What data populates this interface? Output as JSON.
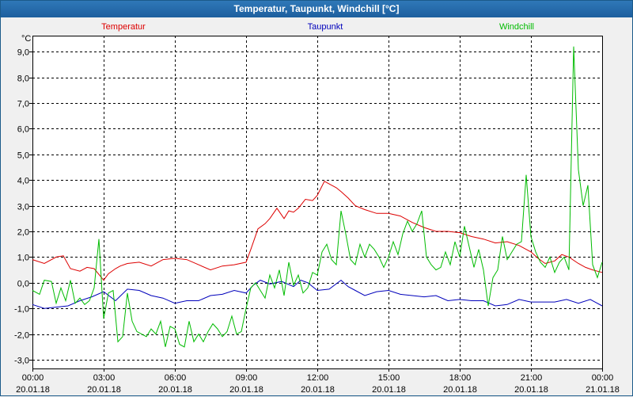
{
  "window": {
    "title": "Temperatur, Taupunkt, Windchill [°C]"
  },
  "chart_data": {
    "type": "line",
    "title": "Temperatur, Taupunkt, Windchill [°C]",
    "y_unit": "°C",
    "ylim": [
      -3.25,
      9.7
    ],
    "xlim_hours": [
      0,
      24
    ],
    "grid": true,
    "legend_placement": "top",
    "y_ticks": [
      "-3,0",
      "-2,0",
      "-1,0",
      "0,0",
      "1,0",
      "2,0",
      "3,0",
      "4,0",
      "5,0",
      "6,0",
      "7,0",
      "8,0",
      "9,0"
    ],
    "y_tick_values": [
      -3,
      -2,
      -1,
      0,
      1,
      2,
      3,
      4,
      5,
      6,
      7,
      8,
      9
    ],
    "x_ticks": [
      {
        "time": "00:00",
        "date": "20.01.18"
      },
      {
        "time": "03:00",
        "date": "20.01.18"
      },
      {
        "time": "06:00",
        "date": "20.01.18"
      },
      {
        "time": "09:00",
        "date": "20.01.18"
      },
      {
        "time": "12:00",
        "date": "20.01.18"
      },
      {
        "time": "15:00",
        "date": "20.01.18"
      },
      {
        "time": "18:00",
        "date": "20.01.18"
      },
      {
        "time": "21:00",
        "date": "20.01.18"
      },
      {
        "time": "00:00",
        "date": "21.01.18"
      }
    ],
    "x_tick_hours": [
      0,
      3,
      6,
      9,
      12,
      15,
      18,
      21,
      24
    ],
    "series": [
      {
        "name": "Temperatur",
        "color": "#dd0000",
        "x": [
          0,
          0.5,
          1,
          1.3,
          1.6,
          2,
          2.3,
          2.6,
          3,
          3.2,
          3.5,
          3.7,
          4,
          4.5,
          5,
          5.5,
          6,
          6.5,
          7,
          7.5,
          8,
          8.5,
          9,
          9.2,
          9.5,
          9.8,
          10,
          10.3,
          10.6,
          10.8,
          11,
          11.2,
          11.5,
          11.8,
          12,
          12.3,
          12.6,
          12.8,
          13,
          13.3,
          13.6,
          14,
          14.5,
          15,
          15.5,
          16,
          16.5,
          17,
          17.5,
          18,
          18.5,
          19,
          19.5,
          20,
          20.5,
          21,
          21.3,
          21.6,
          22,
          22.3,
          22.6,
          23,
          23.3,
          23.6,
          24
        ],
        "y": [
          0.9,
          0.75,
          1.0,
          1.05,
          0.55,
          0.45,
          0.6,
          0.55,
          0.1,
          0.35,
          0.55,
          0.65,
          0.75,
          0.8,
          0.65,
          0.9,
          0.95,
          0.9,
          0.7,
          0.5,
          0.65,
          0.7,
          0.8,
          1.3,
          2.1,
          2.3,
          2.5,
          2.9,
          2.5,
          2.8,
          2.75,
          2.9,
          3.25,
          3.2,
          3.4,
          3.95,
          3.8,
          3.7,
          3.55,
          3.3,
          3.0,
          2.85,
          2.7,
          2.7,
          2.6,
          2.35,
          2.15,
          2.0,
          2.0,
          1.95,
          1.8,
          1.7,
          1.55,
          1.6,
          1.45,
          1.2,
          0.95,
          0.75,
          0.85,
          1.1,
          1.0,
          0.75,
          0.6,
          0.5,
          0.4
        ]
      },
      {
        "name": "Taupunkt",
        "color": "#0000bb",
        "x": [
          0,
          0.5,
          1,
          1.5,
          2,
          2.5,
          3,
          3.5,
          4,
          4.5,
          5,
          5.5,
          6,
          6.5,
          7,
          7.5,
          8,
          8.5,
          9,
          9.3,
          9.6,
          10,
          10.5,
          11,
          11.3,
          11.6,
          12,
          12.5,
          13,
          13.3,
          13.6,
          14,
          14.5,
          15,
          15.5,
          16,
          16.5,
          17,
          17.5,
          18,
          18.5,
          19,
          19.5,
          20,
          20.5,
          21,
          21.5,
          22,
          22.5,
          23,
          23.5,
          24
        ],
        "y": [
          -0.85,
          -1.0,
          -0.95,
          -0.9,
          -0.7,
          -0.55,
          -0.35,
          -0.7,
          -0.25,
          -0.3,
          -0.5,
          -0.6,
          -0.8,
          -0.7,
          -0.7,
          -0.5,
          -0.45,
          -0.3,
          -0.4,
          -0.1,
          0.1,
          -0.05,
          0.05,
          -0.15,
          0.1,
          0.0,
          -0.3,
          -0.25,
          0.1,
          -0.15,
          -0.3,
          -0.5,
          -0.35,
          -0.3,
          -0.45,
          -0.5,
          -0.55,
          -0.5,
          -0.7,
          -0.65,
          -0.7,
          -0.7,
          -0.9,
          -0.85,
          -0.65,
          -0.75,
          -0.75,
          -0.75,
          -0.65,
          -0.8,
          -0.65,
          -0.9
        ]
      },
      {
        "name": "Windchill",
        "color": "#00bb00",
        "x": [
          0,
          0.3,
          0.5,
          0.8,
          1,
          1.2,
          1.4,
          1.6,
          1.8,
          2,
          2.2,
          2.4,
          2.6,
          2.8,
          3,
          3.2,
          3.4,
          3.6,
          3.8,
          4,
          4.2,
          4.4,
          4.6,
          4.8,
          5,
          5.2,
          5.4,
          5.6,
          5.8,
          6,
          6.2,
          6.4,
          6.6,
          6.8,
          7,
          7.2,
          7.4,
          7.6,
          7.8,
          8,
          8.2,
          8.4,
          8.6,
          8.8,
          9,
          9.2,
          9.4,
          9.6,
          9.8,
          10,
          10.2,
          10.4,
          10.6,
          10.8,
          11,
          11.2,
          11.4,
          11.6,
          11.8,
          12,
          12.2,
          12.4,
          12.6,
          12.8,
          13,
          13.2,
          13.4,
          13.6,
          13.8,
          14,
          14.2,
          14.4,
          14.6,
          14.8,
          15,
          15.2,
          15.4,
          15.6,
          15.8,
          16,
          16.2,
          16.4,
          16.6,
          16.8,
          17,
          17.2,
          17.4,
          17.6,
          17.8,
          18,
          18.2,
          18.4,
          18.6,
          18.8,
          19,
          19.2,
          19.4,
          19.6,
          19.8,
          20,
          20.2,
          20.4,
          20.6,
          20.8,
          21,
          21.2,
          21.4,
          21.6,
          21.8,
          22,
          22.2,
          22.4,
          22.6,
          22.8,
          23,
          23.2,
          23.4,
          23.6,
          23.8,
          24
        ],
        "y": [
          -0.3,
          -0.45,
          0.1,
          0.05,
          -0.8,
          -0.2,
          -0.7,
          0.1,
          -0.8,
          -0.6,
          -0.85,
          -0.7,
          -0.2,
          1.7,
          -1.4,
          -0.4,
          -0.3,
          -2.3,
          -2.1,
          -0.4,
          -1.5,
          -1.9,
          -2.0,
          -2.1,
          -1.8,
          -2.0,
          -1.5,
          -2.5,
          -1.7,
          -1.8,
          -2.4,
          -2.5,
          -1.5,
          -2.3,
          -2.0,
          -2.3,
          -1.9,
          -1.6,
          -1.8,
          -2.1,
          -1.9,
          -1.3,
          -2.0,
          -1.9,
          -1.0,
          -0.2,
          0.0,
          -0.3,
          -0.6,
          0.3,
          -0.2,
          0.5,
          -0.5,
          0.8,
          -0.1,
          0.3,
          -0.4,
          -0.2,
          0.4,
          0.3,
          1.2,
          1.5,
          0.9,
          0.7,
          2.8,
          1.9,
          0.9,
          0.7,
          1.5,
          1.0,
          1.5,
          1.3,
          1.0,
          0.6,
          1.0,
          1.6,
          1.1,
          1.9,
          2.4,
          2.0,
          2.3,
          2.8,
          1.0,
          0.7,
          0.5,
          0.6,
          1.2,
          0.7,
          1.6,
          1.0,
          2.2,
          1.4,
          0.6,
          1.3,
          0.5,
          -0.9,
          0.2,
          0.5,
          1.8,
          0.9,
          1.2,
          1.5,
          1.6,
          4.2,
          1.8,
          1.2,
          0.8,
          0.6,
          1.0,
          0.4,
          0.8,
          1.0,
          0.5,
          9.2,
          4.4,
          3.0,
          3.8,
          0.7,
          0.2,
          0.8
        ]
      }
    ]
  }
}
